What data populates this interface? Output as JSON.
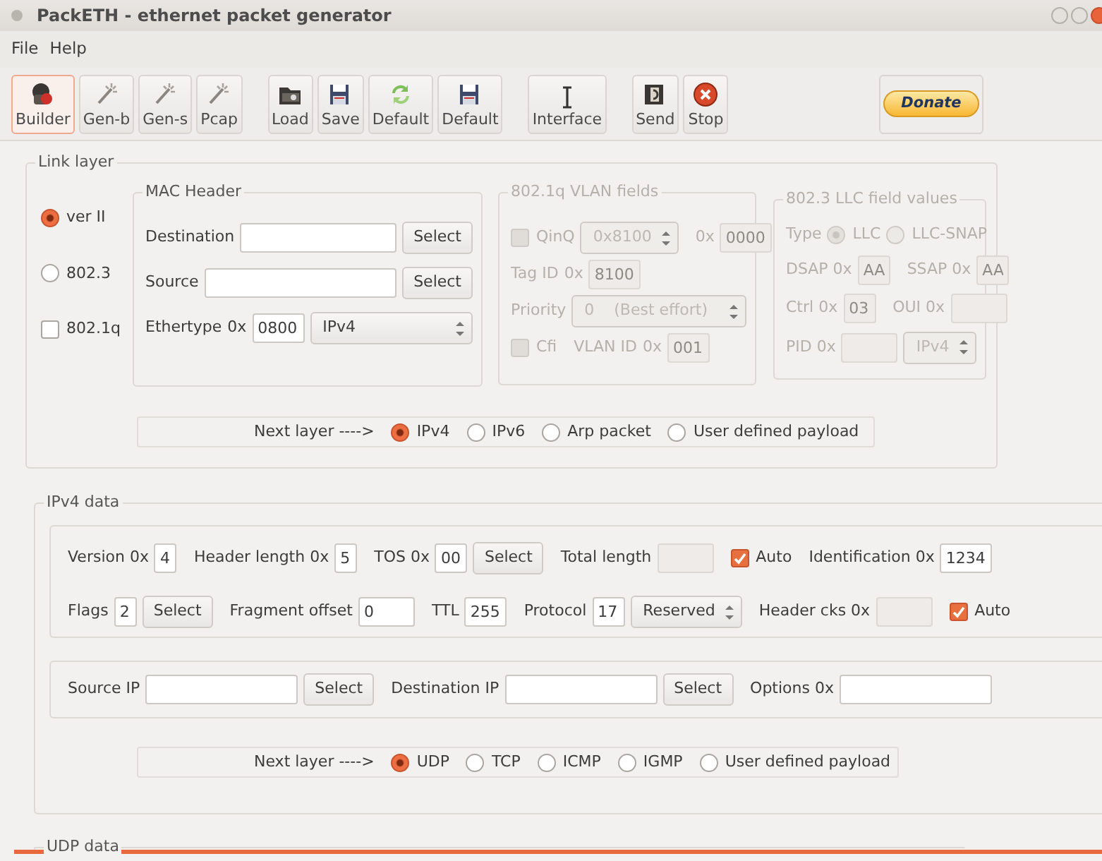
{
  "window": {
    "title": "PackETH - ethernet packet generator"
  },
  "menu": [
    "File",
    "Help"
  ],
  "toolbar": {
    "groups": [
      [
        {
          "label": "Builder",
          "selected": true
        },
        {
          "label": "Gen-b",
          "selected": false
        },
        {
          "label": "Gen-s",
          "selected": false
        },
        {
          "label": "Pcap",
          "selected": false
        }
      ],
      [
        {
          "label": "Load",
          "selected": false
        },
        {
          "label": "Save",
          "selected": false
        },
        {
          "label": "Default",
          "selected": false
        },
        {
          "label": "Default",
          "selected": false
        }
      ],
      [
        {
          "label": "Interface",
          "selected": false
        }
      ],
      [
        {
          "label": "Send",
          "selected": false
        },
        {
          "label": "Stop",
          "selected": false
        }
      ]
    ],
    "donate": "Donate"
  },
  "link_layer": {
    "title": "Link layer",
    "frame_types": [
      {
        "kind": "radio",
        "label": "ver II",
        "checked": true
      },
      {
        "kind": "radio",
        "label": "802.3",
        "checked": false
      },
      {
        "kind": "check",
        "label": "802.1q",
        "checked": false
      }
    ],
    "mac_header": {
      "title": "MAC Header",
      "lines": [
        {
          "items": [
            {
              "kind": "label",
              "text": "Destination"
            },
            {
              "kind": "entry"
            },
            {
              "kind": "button",
              "text": "Select"
            }
          ]
        },
        {
          "items": [
            {
              "kind": "label",
              "text": "Source"
            },
            {
              "kind": "entry"
            },
            {
              "kind": "button",
              "text": "Select"
            }
          ]
        },
        {
          "items": [
            {
              "kind": "label",
              "text": "Ethertype"
            },
            {
              "kind": "label",
              "text": "0x"
            },
            {
              "kind": "field",
              "value": "0800"
            },
            {
              "kind": "select",
              "value": "IPv4"
            }
          ]
        }
      ]
    },
    "vlan": {
      "title": "802.1q VLAN fields",
      "disabled": true,
      "lines": [
        {
          "items": [
            {
              "kind": "check",
              "label": "QinQ",
              "checked": false
            },
            {
              "kind": "select",
              "value": "0x8100"
            },
            {
              "kind": "label",
              "text": "0x"
            },
            {
              "kind": "field",
              "value": "0000"
            }
          ]
        },
        {
          "items": [
            {
              "kind": "label",
              "text": "Tag ID"
            },
            {
              "kind": "label",
              "text": "0x"
            },
            {
              "kind": "field",
              "value": "8100"
            }
          ]
        },
        {
          "items": [
            {
              "kind": "label",
              "text": "Priority"
            },
            {
              "kind": "select",
              "value": "0    (Best effort)"
            }
          ]
        },
        {
          "items": [
            {
              "kind": "check",
              "label": "Cfi",
              "checked": false
            },
            {
              "kind": "label",
              "text": "VLAN ID"
            },
            {
              "kind": "label",
              "text": "0x"
            },
            {
              "kind": "field",
              "value": "001"
            }
          ]
        }
      ]
    },
    "llc": {
      "title": "802.3 LLC field values",
      "disabled": true,
      "lines": [
        {
          "items": [
            {
              "kind": "label",
              "text": "Type"
            },
            {
              "kind": "radio",
              "label": "LLC",
              "checked": true
            },
            {
              "kind": "radio",
              "label": "LLC-SNAP",
              "checked": false
            }
          ]
        },
        {
          "items": [
            {
              "kind": "label",
              "text": "DSAP 0x"
            },
            {
              "kind": "field",
              "value": "AA"
            },
            {
              "kind": "label",
              "text": "SSAP 0x"
            },
            {
              "kind": "field",
              "value": "AA"
            }
          ]
        },
        {
          "items": [
            {
              "kind": "label",
              "text": "Ctrl 0x"
            },
            {
              "kind": "field",
              "value": "03"
            },
            {
              "kind": "label",
              "text": "OUI 0x"
            },
            {
              "kind": "box"
            }
          ]
        },
        {
          "items": [
            {
              "kind": "label",
              "text": "PID 0x"
            },
            {
              "kind": "box"
            },
            {
              "kind": "select",
              "value": "IPv4"
            }
          ]
        }
      ]
    },
    "next_layer": {
      "label": "Next layer ---->",
      "options": [
        {
          "label": "IPv4",
          "selected": true
        },
        {
          "label": "IPv6",
          "selected": false
        },
        {
          "label": "Arp packet",
          "selected": false
        },
        {
          "label": "User defined payload",
          "selected": false
        }
      ]
    }
  },
  "ipv4": {
    "title": "IPv4 data",
    "groups": [
      {
        "lines": [
          {
            "items": [
              {
                "kind": "label",
                "text": "Version 0x"
              },
              {
                "kind": "field",
                "value": "4"
              },
              {
                "kind": "label",
                "text": "Header length 0x"
              },
              {
                "kind": "field",
                "value": "5"
              },
              {
                "kind": "label",
                "text": "TOS 0x"
              },
              {
                "kind": "field",
                "value": "00"
              },
              {
                "kind": "button",
                "text": "Select"
              },
              {
                "kind": "label",
                "text": "Total length"
              },
              {
                "kind": "box",
                "disabled": true
              },
              {
                "kind": "check",
                "label": "Auto",
                "checked": true
              },
              {
                "kind": "label",
                "text": "Identification 0x"
              },
              {
                "kind": "field",
                "value": "1234"
              }
            ]
          },
          {
            "items": [
              {
                "kind": "label",
                "text": "Flags"
              },
              {
                "kind": "field",
                "value": "2"
              },
              {
                "kind": "button",
                "text": "Select"
              },
              {
                "kind": "label",
                "text": "Fragment offset"
              },
              {
                "kind": "box",
                "value": "0"
              },
              {
                "kind": "label",
                "text": "TTL"
              },
              {
                "kind": "field",
                "value": "255"
              },
              {
                "kind": "label",
                "text": "Protocol"
              },
              {
                "kind": "field",
                "value": "17"
              },
              {
                "kind": "select",
                "value": "Reserved"
              },
              {
                "kind": "label",
                "text": "Header cks 0x"
              },
              {
                "kind": "box",
                "disabled": true
              },
              {
                "kind": "check",
                "label": "Auto",
                "checked": true
              }
            ]
          }
        ]
      },
      {
        "lines": [
          {
            "items": [
              {
                "kind": "label",
                "text": "Source IP"
              },
              {
                "kind": "entry"
              },
              {
                "kind": "button",
                "text": "Select"
              },
              {
                "kind": "label",
                "text": "Destination IP"
              },
              {
                "kind": "entry"
              },
              {
                "kind": "button",
                "text": "Select"
              },
              {
                "kind": "label",
                "text": "Options 0x"
              },
              {
                "kind": "entry"
              }
            ]
          }
        ]
      }
    ],
    "next_layer": {
      "label": "Next layer ---->",
      "options": [
        {
          "label": "UDP",
          "selected": true
        },
        {
          "label": "TCP",
          "selected": false
        },
        {
          "label": "ICMP",
          "selected": false
        },
        {
          "label": "IGMP",
          "selected": false
        },
        {
          "label": "User defined payload",
          "selected": false
        }
      ]
    }
  },
  "udp": {
    "title": "UDP data"
  }
}
